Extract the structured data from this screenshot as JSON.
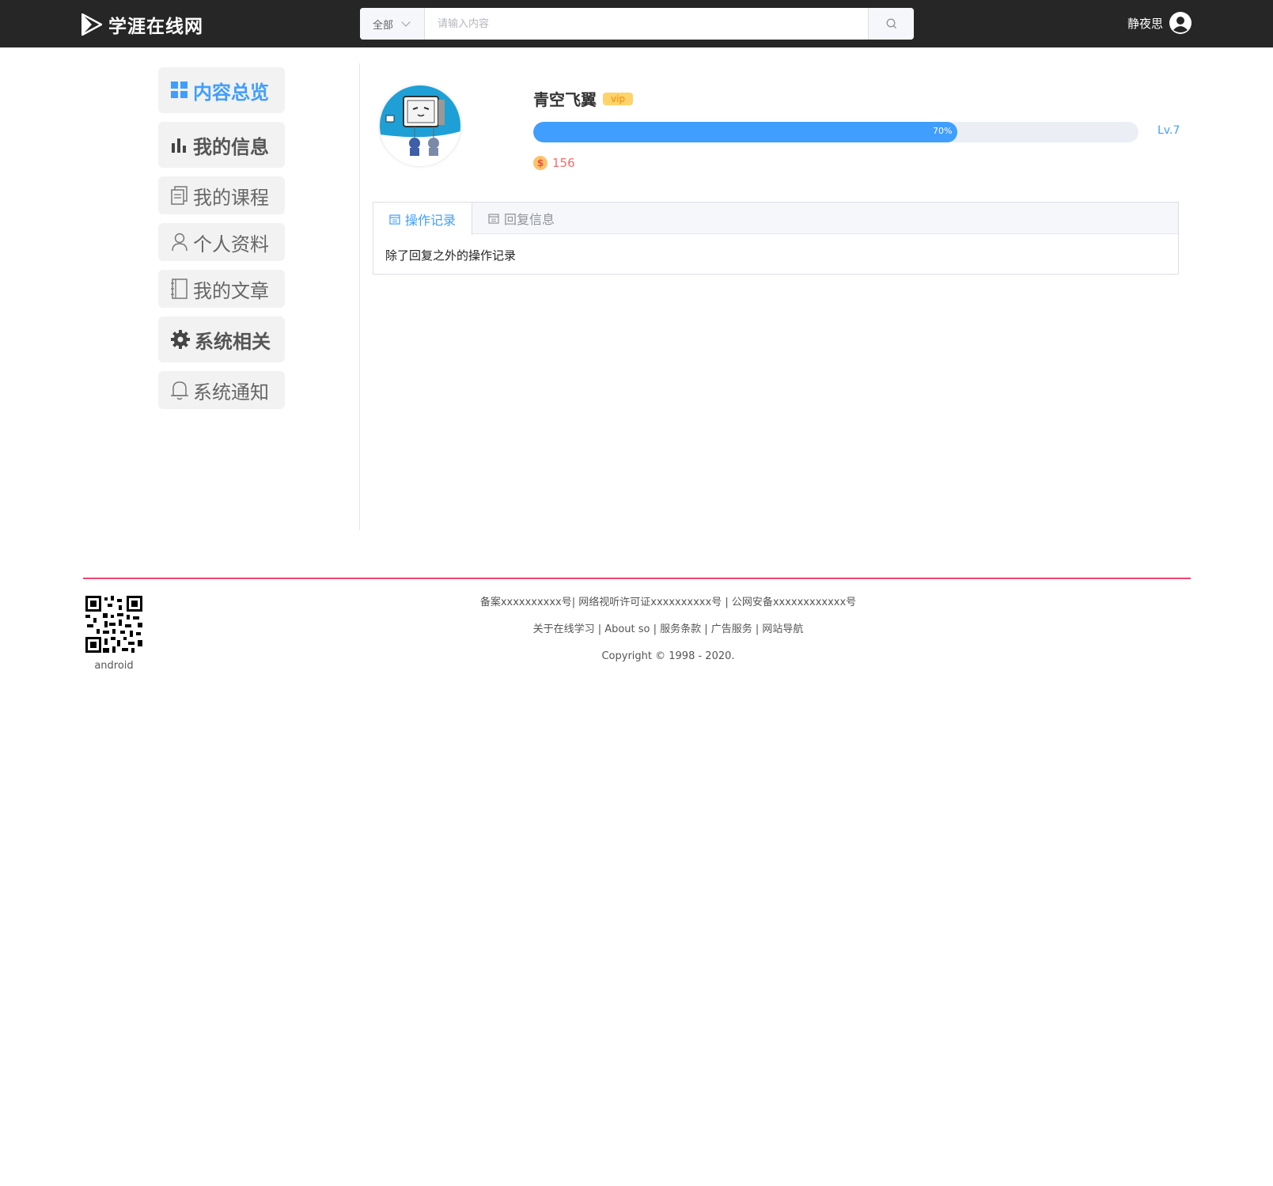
{
  "header": {
    "logo_text": "学涯在线网",
    "search": {
      "category": "全部",
      "placeholder": "请输入内容"
    },
    "username": "静夜思"
  },
  "sidebar": {
    "items": [
      {
        "label": "内容总览",
        "icon": "grid-icon"
      },
      {
        "label": "我的信息",
        "icon": "bar-chart-icon"
      },
      {
        "label": "我的课程",
        "icon": "document-icon"
      },
      {
        "label": "个人资料",
        "icon": "user-icon"
      },
      {
        "label": "我的文章",
        "icon": "notebook-icon"
      },
      {
        "label": "系统相关",
        "icon": "gear-icon"
      },
      {
        "label": "系统通知",
        "icon": "bell-icon"
      }
    ]
  },
  "profile": {
    "name": "青空飞翼",
    "badge": "vip",
    "progress": 70,
    "progress_label": "70%",
    "level": "Lv.7",
    "coin_symbol": "$",
    "coins": "156"
  },
  "tabs": {
    "items": [
      {
        "label": "操作记录",
        "active": true
      },
      {
        "label": "回复信息",
        "active": false
      }
    ],
    "content": "除了回复之外的操作记录"
  },
  "footer": {
    "qr_label": "android",
    "line1": "备案xxxxxxxxxx号| 网络视听许可证xxxxxxxxxx号 | 公网安备xxxxxxxxxxxx号",
    "line2": "关于在线学习 | About so | 服务条款 | 广告服务 | 网站导航",
    "line3": "Copyright © 1998 - 2020."
  },
  "colors": {
    "header_bg": "#262626",
    "accent": "#409eff",
    "footer_line": "#f0466e",
    "coins": "#f56c6c"
  }
}
